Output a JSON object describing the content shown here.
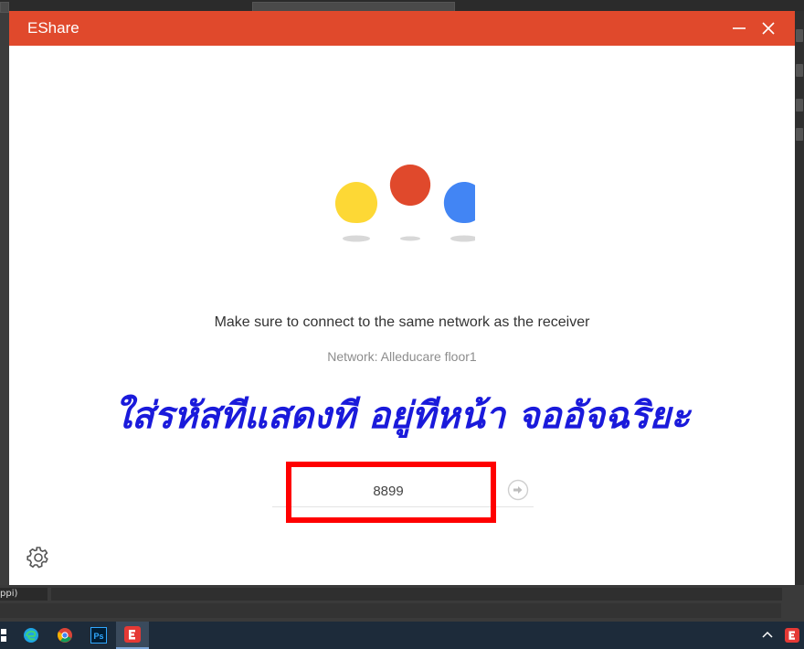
{
  "window": {
    "title": "EShare"
  },
  "main": {
    "instruction": "Make sure to connect to the same network as the receiver",
    "network": "Network: Alleducare floor1",
    "annotation": "ใส่รหัสทีแสดงที อยู่ทีหน้า จออัจฉริยะ",
    "code_value": "8899"
  },
  "background": {
    "strip_label": "ppi)"
  },
  "icons": {
    "pins": [
      "yellow-pin-icon",
      "red-pin-icon",
      "blue-pin-icon"
    ],
    "settings": "gear-icon",
    "go": "arrow-right-circle-icon",
    "minimize": "minimize-icon",
    "close": "close-icon"
  },
  "colors": {
    "titlebar": "#e0492c",
    "annotation_text": "#1a1adb",
    "highlight_box": "#ff0000",
    "pin_yellow": "#fdd835",
    "pin_red": "#e0492c",
    "pin_blue": "#4285f4"
  },
  "taskbar": {
    "items": [
      "windows-start-icon",
      "edge-icon",
      "chrome-icon",
      "photoshop-icon",
      "eshare-icon"
    ],
    "photoshop_label": "Ps"
  }
}
